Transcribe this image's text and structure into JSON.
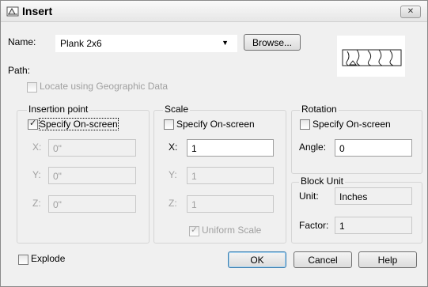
{
  "window": {
    "title": "Insert",
    "close_symbol": "✕"
  },
  "name_row": {
    "label": "Name:",
    "value": "Plank 2x6",
    "browse_label": "Browse..."
  },
  "path": {
    "label": "Path:"
  },
  "geo": {
    "label": "Locate using Geographic Data",
    "checked": false
  },
  "insertion": {
    "title": "Insertion point",
    "specify_label": "Specify On-screen",
    "specify_checked": true,
    "x_label": "X:",
    "x_value": "0\"",
    "y_label": "Y:",
    "y_value": "0\"",
    "z_label": "Z:",
    "z_value": "0\""
  },
  "scale": {
    "title": "Scale",
    "specify_label": "Specify On-screen",
    "specify_checked": false,
    "x_label": "X:",
    "x_value": "1",
    "y_label": "Y:",
    "y_value": "1",
    "z_label": "Z:",
    "z_value": "1",
    "uniform_label": "Uniform Scale",
    "uniform_checked": true
  },
  "rotation": {
    "title": "Rotation",
    "specify_label": "Specify On-screen",
    "specify_checked": false,
    "angle_label": "Angle:",
    "angle_value": "0"
  },
  "block_unit": {
    "title": "Block Unit",
    "unit_label": "Unit:",
    "unit_value": "Inches",
    "factor_label": "Factor:",
    "factor_value": "1"
  },
  "explode": {
    "label": "Explode",
    "checked": false
  },
  "buttons": {
    "ok": "OK",
    "cancel": "Cancel",
    "help": "Help"
  }
}
